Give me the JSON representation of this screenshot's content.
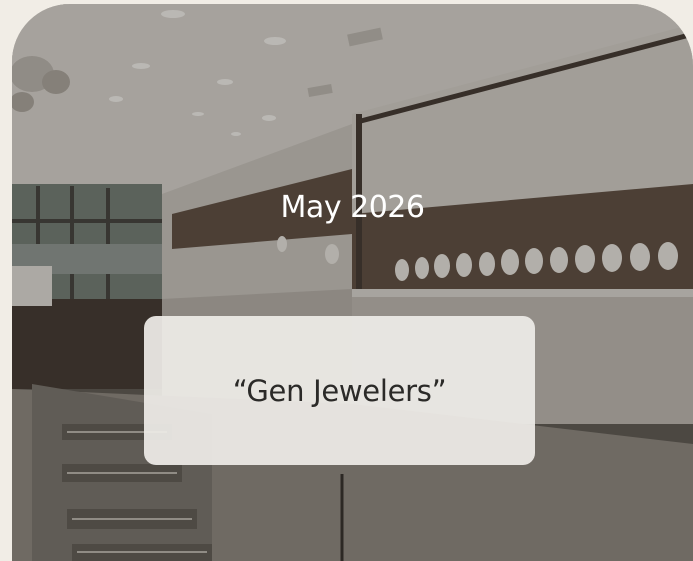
{
  "card": {
    "date": "May 2026",
    "quote": "“Gen Jewelers”"
  },
  "photo": {
    "description_icon": "jewelry-store-interior-image"
  },
  "colors": {
    "page_background": "#f1ede6",
    "text_light": "#ffffff",
    "quote_box": "#eeece7",
    "quote_text": "#2b2a28"
  }
}
